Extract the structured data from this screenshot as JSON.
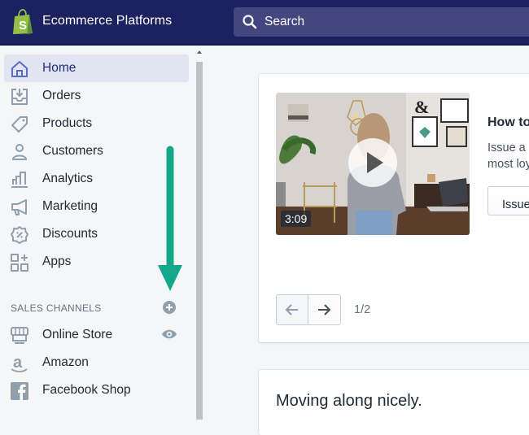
{
  "topbar": {
    "logo_icon": "shopify-bag-icon",
    "store_name": "Ecommerce Platforms",
    "search_placeholder": "Search",
    "colors": {
      "background": "#1c2260",
      "search_bg": "#43467f",
      "logo_green": "#95bf47"
    }
  },
  "sidebar": {
    "items": [
      {
        "label": "Home",
        "icon": "home-icon",
        "active": true
      },
      {
        "label": "Orders",
        "icon": "orders-inbox-icon",
        "active": false
      },
      {
        "label": "Products",
        "icon": "tag-icon",
        "active": false
      },
      {
        "label": "Customers",
        "icon": "person-icon",
        "active": false
      },
      {
        "label": "Analytics",
        "icon": "bar-chart-icon",
        "active": false
      },
      {
        "label": "Marketing",
        "icon": "megaphone-icon",
        "active": false
      },
      {
        "label": "Discounts",
        "icon": "discount-badge-icon",
        "active": false
      },
      {
        "label": "Apps",
        "icon": "apps-grid-icon",
        "active": false
      }
    ],
    "sales_channels": {
      "heading": "SALES CHANNELS",
      "add_icon": "plus-circle-icon",
      "items": [
        {
          "label": "Online Store",
          "icon": "storefront-icon",
          "action_icon": "eye-icon"
        },
        {
          "label": "Amazon",
          "icon": "amazon-icon"
        },
        {
          "label": "Facebook Shop",
          "icon": "facebook-icon"
        }
      ]
    },
    "colors": {
      "active_bg": "#e1e5f2",
      "active_text": "#202e78",
      "annotation_arrow": "#14a88a"
    }
  },
  "main": {
    "tip_card": {
      "video_duration": "3:09",
      "play_icon": "play-icon",
      "title": "How to",
      "body_line1": "Issue a g",
      "body_line2": "most loy",
      "button_label": "Issue",
      "pager": {
        "prev_icon": "arrow-left-icon",
        "next_icon": "arrow-right-icon",
        "count": "1/2"
      }
    },
    "progress_card": {
      "heading": "Moving along nicely."
    }
  }
}
